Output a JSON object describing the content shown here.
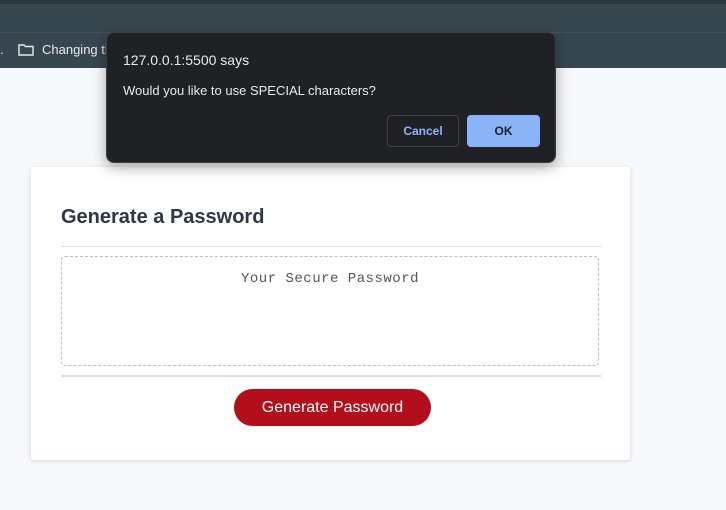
{
  "browser": {
    "bookmark_prefix": ".",
    "bookmark_folder_label": "Changing th",
    "folder_icon": "folder-icon"
  },
  "dialog": {
    "origin": "127.0.0.1:5500 says",
    "message": "Would you like to use SPECIAL characters?",
    "cancel_label": "Cancel",
    "ok_label": "OK"
  },
  "card": {
    "title": "Generate a Password",
    "password_placeholder": "Your Secure Password",
    "password_value": "",
    "generate_label": "Generate Password"
  },
  "colors": {
    "chrome_bar": "#37474f",
    "dialog_bg": "#202124",
    "ok_button": "#8ab4f8",
    "generate_button": "#b20f1b",
    "page_bg": "#f7f8fb"
  }
}
